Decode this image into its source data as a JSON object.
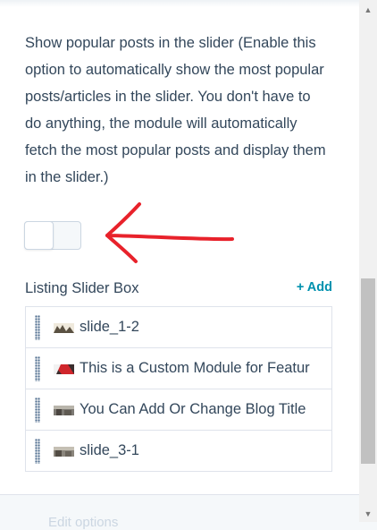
{
  "setting": {
    "description": "Show popular posts in the slider (Enable this option to automatically show the most popular posts/articles in the slider. You don't have to do anything, the module will automatically fetch the most popular posts and display them in the slider.)",
    "toggle_on": false
  },
  "listing": {
    "title": "Listing Slider Box",
    "add_label": "+ Add",
    "items": [
      {
        "label": "slide_1-2",
        "thumb": "landscape-thumbnail"
      },
      {
        "label": "This is a Custom Module for Featur",
        "thumb": "red-banner-thumbnail"
      },
      {
        "label": "You Can Add Or Change Blog Title",
        "thumb": "photo-thumbnail"
      },
      {
        "label": "slide_3-1",
        "thumb": "photo-thumbnail"
      }
    ]
  },
  "footer": {
    "edit_options_label": "Edit options"
  },
  "colors": {
    "accent": "#0091ae",
    "text": "#33475b",
    "annotation_arrow": "#e8222b"
  }
}
